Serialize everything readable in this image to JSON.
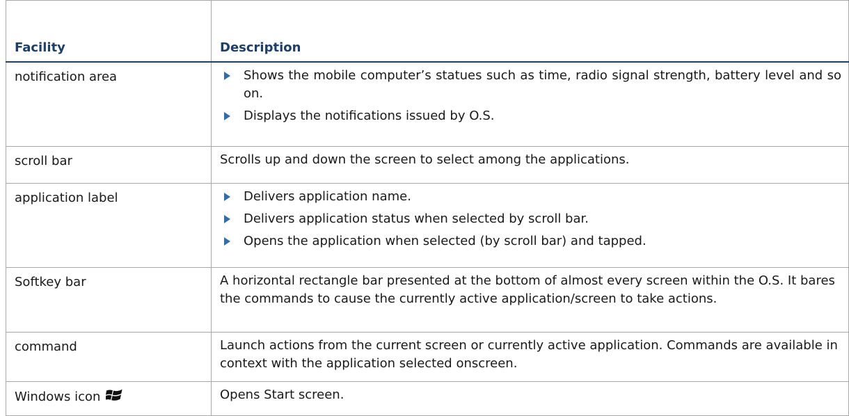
{
  "header": {
    "facility": "Facility",
    "description": "Description"
  },
  "rows": [
    {
      "facility": "notification area",
      "bullets": [
        "Shows the mobile computer’s statues such as time, radio signal strength, battery level and so on.",
        "Displays the notifications issued by O.S."
      ]
    },
    {
      "facility": "scroll bar",
      "text": "Scrolls up and down the screen to select among the applications."
    },
    {
      "facility": "application label",
      "bullets": [
        "Delivers application name.",
        "Delivers application status when selected by scroll bar.",
        "Opens the application when selected (by scroll bar) and tapped."
      ]
    },
    {
      "facility": "Softkey bar",
      "text": "A horizontal rectangle bar presented at the bottom of almost every screen within the O.S. It bares the commands to cause the currently active application/screen to take actions."
    },
    {
      "facility": "command",
      "text": "Launch actions from the current screen or currently active application. Commands are available in context with the application selected onscreen."
    },
    {
      "facility": "Windows icon",
      "icon": "windows-logo-icon",
      "text": "Opens Start screen."
    }
  ],
  "colors": {
    "header_text": "#1c3f6b",
    "bullet": "#2f6db3",
    "border": "#a8a8a8"
  }
}
